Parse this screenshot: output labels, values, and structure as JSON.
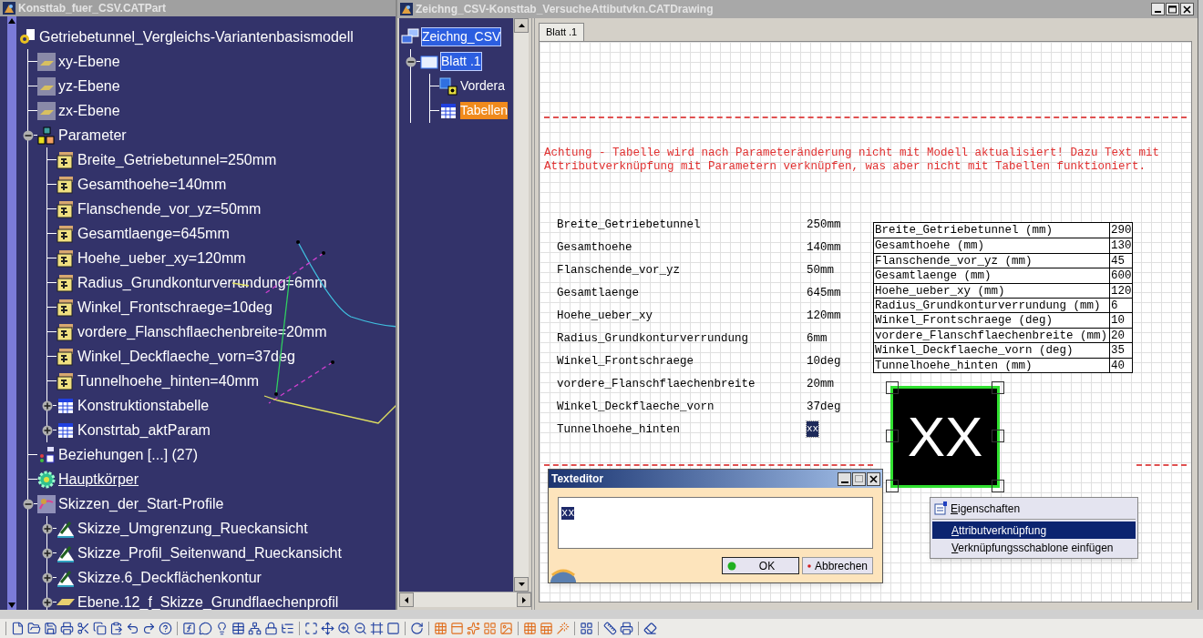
{
  "part_window": {
    "title": "Konsttab_fuer_CSV.CATPart",
    "tree": {
      "label": "Getriebetunnel_Vergleichs-Variantenbasismodell",
      "kind": "root",
      "children": [
        {
          "label": "xy-Ebene",
          "kind": "plane",
          "current": false
        },
        {
          "label": "yz-Ebene",
          "kind": "plane",
          "current": false
        },
        {
          "label": "zx-Ebene",
          "kind": "plane",
          "current": false
        },
        {
          "label": "Parameter",
          "kind": "parameters",
          "current": false,
          "expanded": true,
          "children": [
            {
              "label": "Breite_Getriebetunnel=250mm",
              "kind": "parameter"
            },
            {
              "label": "Gesamthoehe=140mm",
              "kind": "parameter"
            },
            {
              "label": "Flanschende_vor_yz=50mm",
              "kind": "parameter"
            },
            {
              "label": "Gesamtlaenge=645mm",
              "kind": "parameter"
            },
            {
              "label": "Hoehe_ueber_xy=120mm",
              "kind": "parameter"
            },
            {
              "label": "Radius_Grundkonturverrundung=6mm",
              "kind": "parameter"
            },
            {
              "label": "Winkel_Frontschraege=10deg",
              "kind": "parameter"
            },
            {
              "label": "vordere_Flanschflaechenbreite=20mm",
              "kind": "parameter"
            },
            {
              "label": "Winkel_Deckflaeche_vorn=37deg",
              "kind": "parameter"
            },
            {
              "label": "Tunnelhoehe_hinten=40mm",
              "kind": "parameter"
            },
            {
              "label": "Konstruktionstabelle",
              "kind": "table",
              "expanded": false
            },
            {
              "label": "Konstrtab_aktParam",
              "kind": "table",
              "expanded": false
            }
          ]
        },
        {
          "label": "Beziehungen [...] (27)",
          "kind": "relations",
          "current": false
        },
        {
          "label": "Hauptkörper",
          "kind": "body",
          "current": true
        },
        {
          "label": "Skizzen_der_Start-Profile",
          "kind": "sketch-set",
          "current": false,
          "expanded": true,
          "children": [
            {
              "label": "Skizze_Umgrenzung_Rueckansicht",
              "kind": "sketch",
              "expanded": false
            },
            {
              "label": "Skizze_Profil_Seitenwand_Rueckansicht",
              "kind": "sketch",
              "expanded": false
            },
            {
              "label": "Skizze.6_Deckflächenkontur",
              "kind": "sketch",
              "expanded": false
            },
            {
              "label": "Ebene.12_f_Skizze_Grundflaechenprofil",
              "kind": "surface",
              "expanded": false
            }
          ]
        }
      ]
    }
  },
  "drawing_window": {
    "title": "Zeichng_CSV-Konsttab_VersucheAttibutvkn.CATDrawing",
    "tree": {
      "label": "Zeichng_CSV",
      "kind": "document",
      "selected": true,
      "active": false,
      "children": [
        {
          "label": "Blatt .1",
          "kind": "sheet",
          "selected": true,
          "active": false,
          "expanded": true,
          "children": [
            {
              "label": "Vordera",
              "kind": "view",
              "selected": false,
              "active": false
            },
            {
              "label": "Tabellen",
              "kind": "table",
              "selected": false,
              "active": true
            }
          ]
        }
      ]
    },
    "tabs": [
      {
        "label": "Blatt .1",
        "selected": true
      }
    ],
    "notice": [
      "Achtung - Tabelle wird nach Parameteränderung nicht mit Modell aktualisiert! Dazu Text mit",
      "Attributverknüpfung mit Parametern verknüpfen, was aber nicht mit Tabellen funktioniert."
    ],
    "parameters": [
      {
        "name": "Breite_Getriebetunnel",
        "value": "250mm",
        "selected": false
      },
      {
        "name": "Gesamthoehe",
        "value": "140mm",
        "selected": false
      },
      {
        "name": "Flanschende_vor_yz",
        "value": "50mm",
        "selected": false
      },
      {
        "name": "Gesamtlaenge",
        "value": "645mm",
        "selected": false
      },
      {
        "name": "Hoehe_ueber_xy",
        "value": "120mm",
        "selected": false
      },
      {
        "name": "Radius_Grundkonturverrundung",
        "value": "6mm",
        "selected": false
      },
      {
        "name": "Winkel_Frontschraege",
        "value": "10deg",
        "selected": false
      },
      {
        "name": "vordere_Flanschflaechenbreite",
        "value": "20mm",
        "selected": false
      },
      {
        "name": "Winkel_Deckflaeche_vorn",
        "value": "37deg",
        "selected": false
      },
      {
        "name": "Tunnelhoehe_hinten",
        "value": "xx",
        "selected": true
      }
    ],
    "table": {
      "rows": [
        {
          "name": "Breite_Getriebetunnel (mm)",
          "value": "290"
        },
        {
          "name": "Gesamthoehe (mm)",
          "value": "130"
        },
        {
          "name": "Flanschende_vor_yz (mm)",
          "value": "45"
        },
        {
          "name": "Gesamtlaenge (mm)",
          "value": "600"
        },
        {
          "name": "Hoehe_ueber_xy (mm)",
          "value": "120"
        },
        {
          "name": "Radius_Grundkonturverrundung (mm)",
          "value": "6"
        },
        {
          "name": "Winkel_Frontschraege (deg)",
          "value": "10"
        },
        {
          "name": "vordere_Flanschflaechenbreite (mm)",
          "value": "20"
        },
        {
          "name": "Winkel_Deckflaeche_vorn (deg)",
          "value": "35"
        },
        {
          "name": "Tunnelhoehe_hinten (mm)",
          "value": "40"
        }
      ]
    },
    "text_box": {
      "text": "XX",
      "selected": true
    }
  },
  "text_editor": {
    "title": "Texteditor",
    "text": "xx",
    "buttons": [
      {
        "label": "OK",
        "kind": "ok"
      },
      {
        "label": "Abbrechen",
        "kind": "cancel"
      }
    ]
  },
  "context_menu": {
    "items": [
      {
        "kind": "command-with-icon",
        "label": "Eigenschaften",
        "selected": false
      },
      {
        "kind": "separator"
      },
      {
        "kind": "command",
        "label": "Attributverknüpfung",
        "selected": true
      },
      {
        "kind": "command",
        "label": "Verknüpfungsschablone einfügen",
        "selected": false
      }
    ]
  }
}
